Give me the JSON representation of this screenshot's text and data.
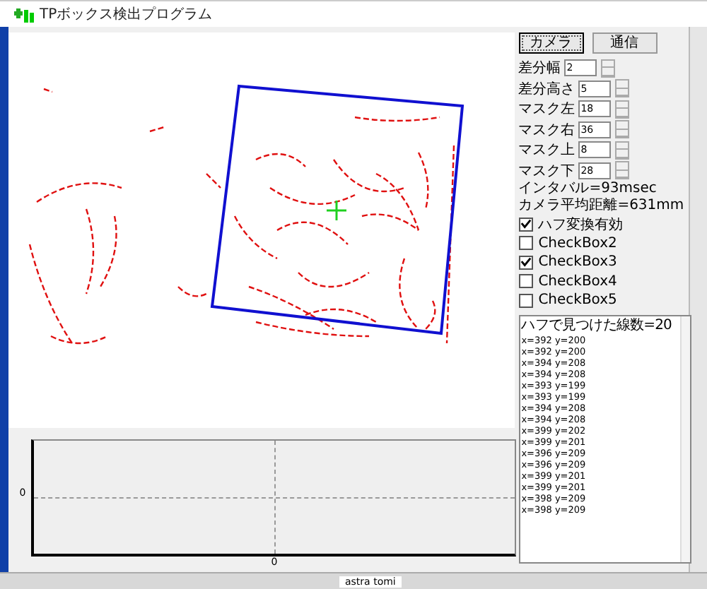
{
  "window": {
    "title": "TPボックス検出プログラム"
  },
  "buttons": [
    {
      "label": "カメラ",
      "selected": true
    },
    {
      "label": "通信",
      "selected": false
    }
  ],
  "spinners": [
    {
      "label": "差分幅",
      "value": "2"
    },
    {
      "label": "差分高さ",
      "value": "5"
    },
    {
      "label": "マスク左",
      "value": "18"
    },
    {
      "label": "マスク右",
      "value": "36"
    },
    {
      "label": "マスク上",
      "value": "8"
    },
    {
      "label": "マスク下",
      "value": "28"
    }
  ],
  "info": [
    "インタバル=93msec",
    "カメラ平均距離=631mm"
  ],
  "checkboxes": [
    {
      "label": "ハフ変換有効",
      "checked": true
    },
    {
      "label": "CheckBox2",
      "checked": false
    },
    {
      "label": "CheckBox3",
      "checked": true
    },
    {
      "label": "CheckBox4",
      "checked": false
    },
    {
      "label": "CheckBox5",
      "checked": false
    }
  ],
  "log": [
    "ハフで見つけた線数=20",
    "x=392 y=200",
    "x=392 y=200",
    "x=394 y=208",
    "x=394 y=208",
    "x=393 y=199",
    "x=393 y=199",
    "x=394 y=208",
    "x=394 y=208",
    "x=399 y=202",
    "x=399 y=201",
    "x=396 y=209",
    "x=396 y=209",
    "x=399 y=201",
    "x=399 y=201",
    "x=398 y=209",
    "x=398 y=209"
  ],
  "chart": {
    "y_tick": "0",
    "x_tick": "0"
  },
  "background": {
    "taskbar_text": "astra tomi"
  }
}
